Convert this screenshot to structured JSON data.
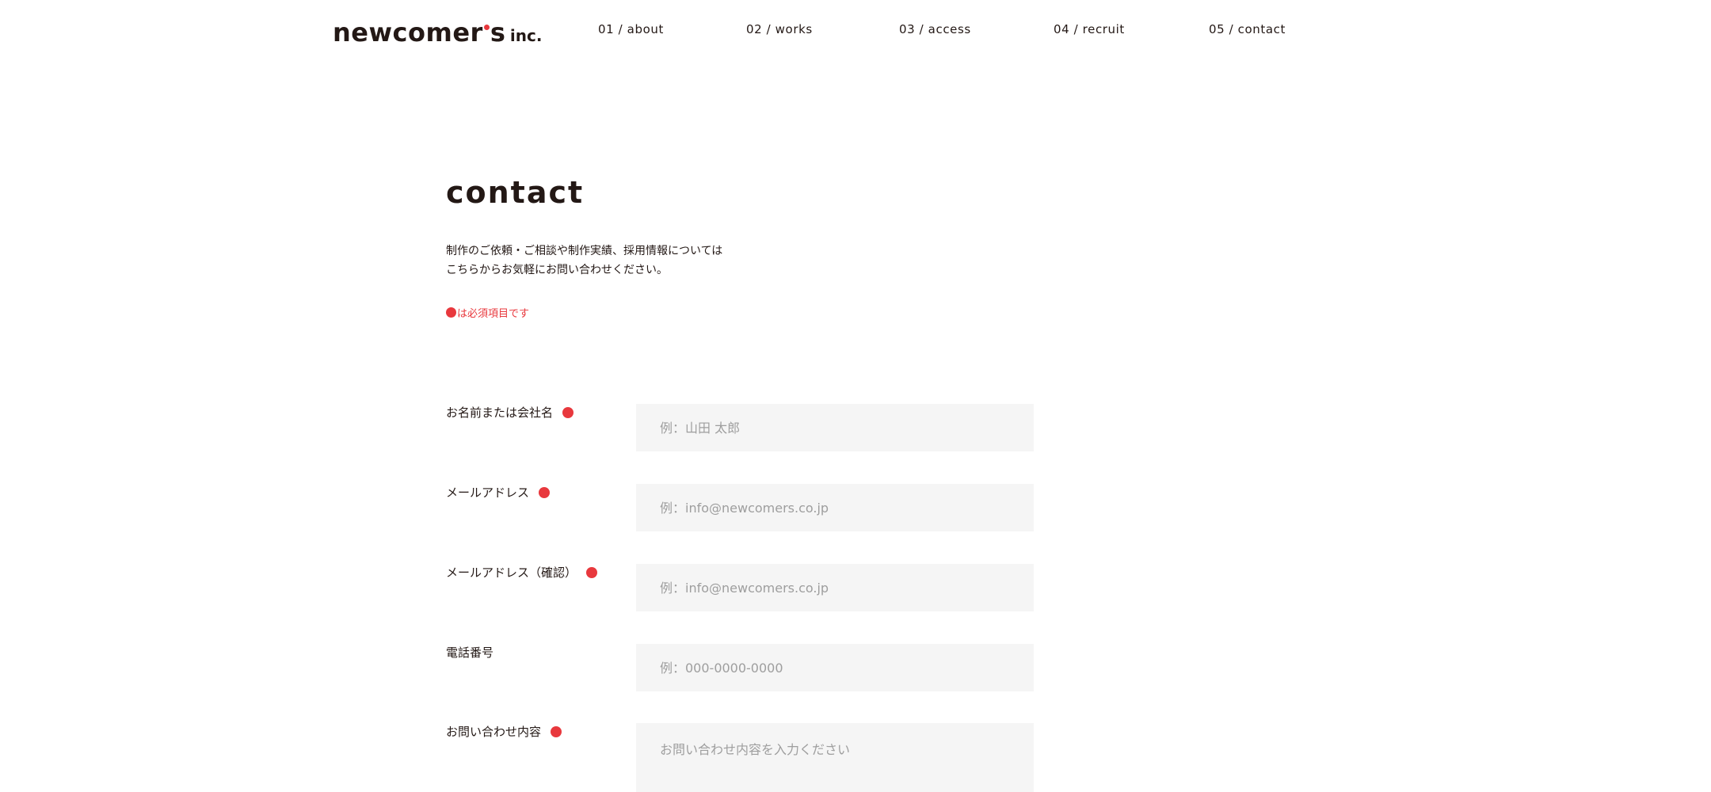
{
  "header": {
    "logo": {
      "main": "newcomer",
      "end": "s",
      "suffix": "inc."
    },
    "nav": [
      {
        "label": "01 / about"
      },
      {
        "label": "02 / works"
      },
      {
        "label": "03 / access"
      },
      {
        "label": "04 / recruit"
      },
      {
        "label": "05 / contact"
      }
    ]
  },
  "main": {
    "title": "contact",
    "intro": [
      "制作のご依頼・ご相談や制作実績、採用情報については",
      "こちらからお気軽にお問い合わせください。"
    ],
    "required_note": "は必須項目です",
    "form": {
      "fields": [
        {
          "label": "お名前または会社名",
          "required": true,
          "placeholder": "例：山田 太郎",
          "value": ""
        },
        {
          "label": "メールアドレス",
          "required": true,
          "placeholder": "例：info@newcomers.co.jp",
          "value": ""
        },
        {
          "label": "メールアドレス（確認）",
          "required": true,
          "placeholder": "例：info@newcomers.co.jp",
          "value": ""
        },
        {
          "label": "電話番号",
          "required": false,
          "placeholder": "例：000-0000-0000",
          "value": ""
        },
        {
          "label": "お問い合わせ内容",
          "required": true,
          "placeholder": "お問い合わせ内容を入力ください",
          "value": ""
        }
      ]
    }
  },
  "colors": {
    "accent": "#e8383d",
    "text": "#231815",
    "field_bg": "#f5f5f5",
    "placeholder": "#9e9e9e"
  }
}
